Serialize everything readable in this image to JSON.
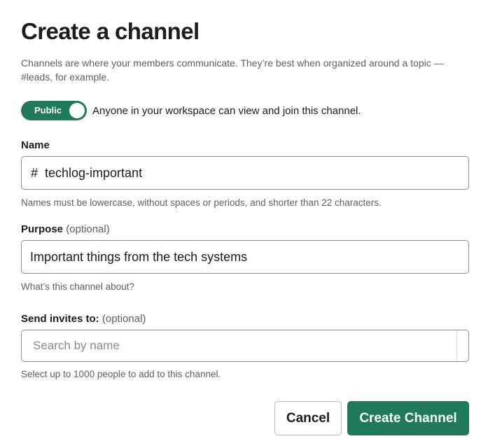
{
  "dialog": {
    "title": "Create a channel",
    "description": "Channels are where your members communicate. They’re best when organized around a topic — #leads, for example."
  },
  "visibility": {
    "toggle_label": "Public",
    "toggle_on": true,
    "text": "Anyone in your workspace can view and join this channel.",
    "accent_color": "#1f7a5a"
  },
  "name_field": {
    "label": "Name",
    "prefix": "#",
    "value": "techlog-important",
    "help": "Names must be lowercase, without spaces or periods, and shorter than 22 characters."
  },
  "purpose_field": {
    "label": "Purpose",
    "optional": "(optional)",
    "value": "Important things from the tech systems",
    "help": "What’s this channel about?"
  },
  "invites_field": {
    "label": "Send invites to:",
    "optional": "(optional)",
    "placeholder": "Search by name",
    "help": "Select up to 1000 people to add to this channel."
  },
  "actions": {
    "cancel_label": "Cancel",
    "create_label": "Create Channel"
  }
}
